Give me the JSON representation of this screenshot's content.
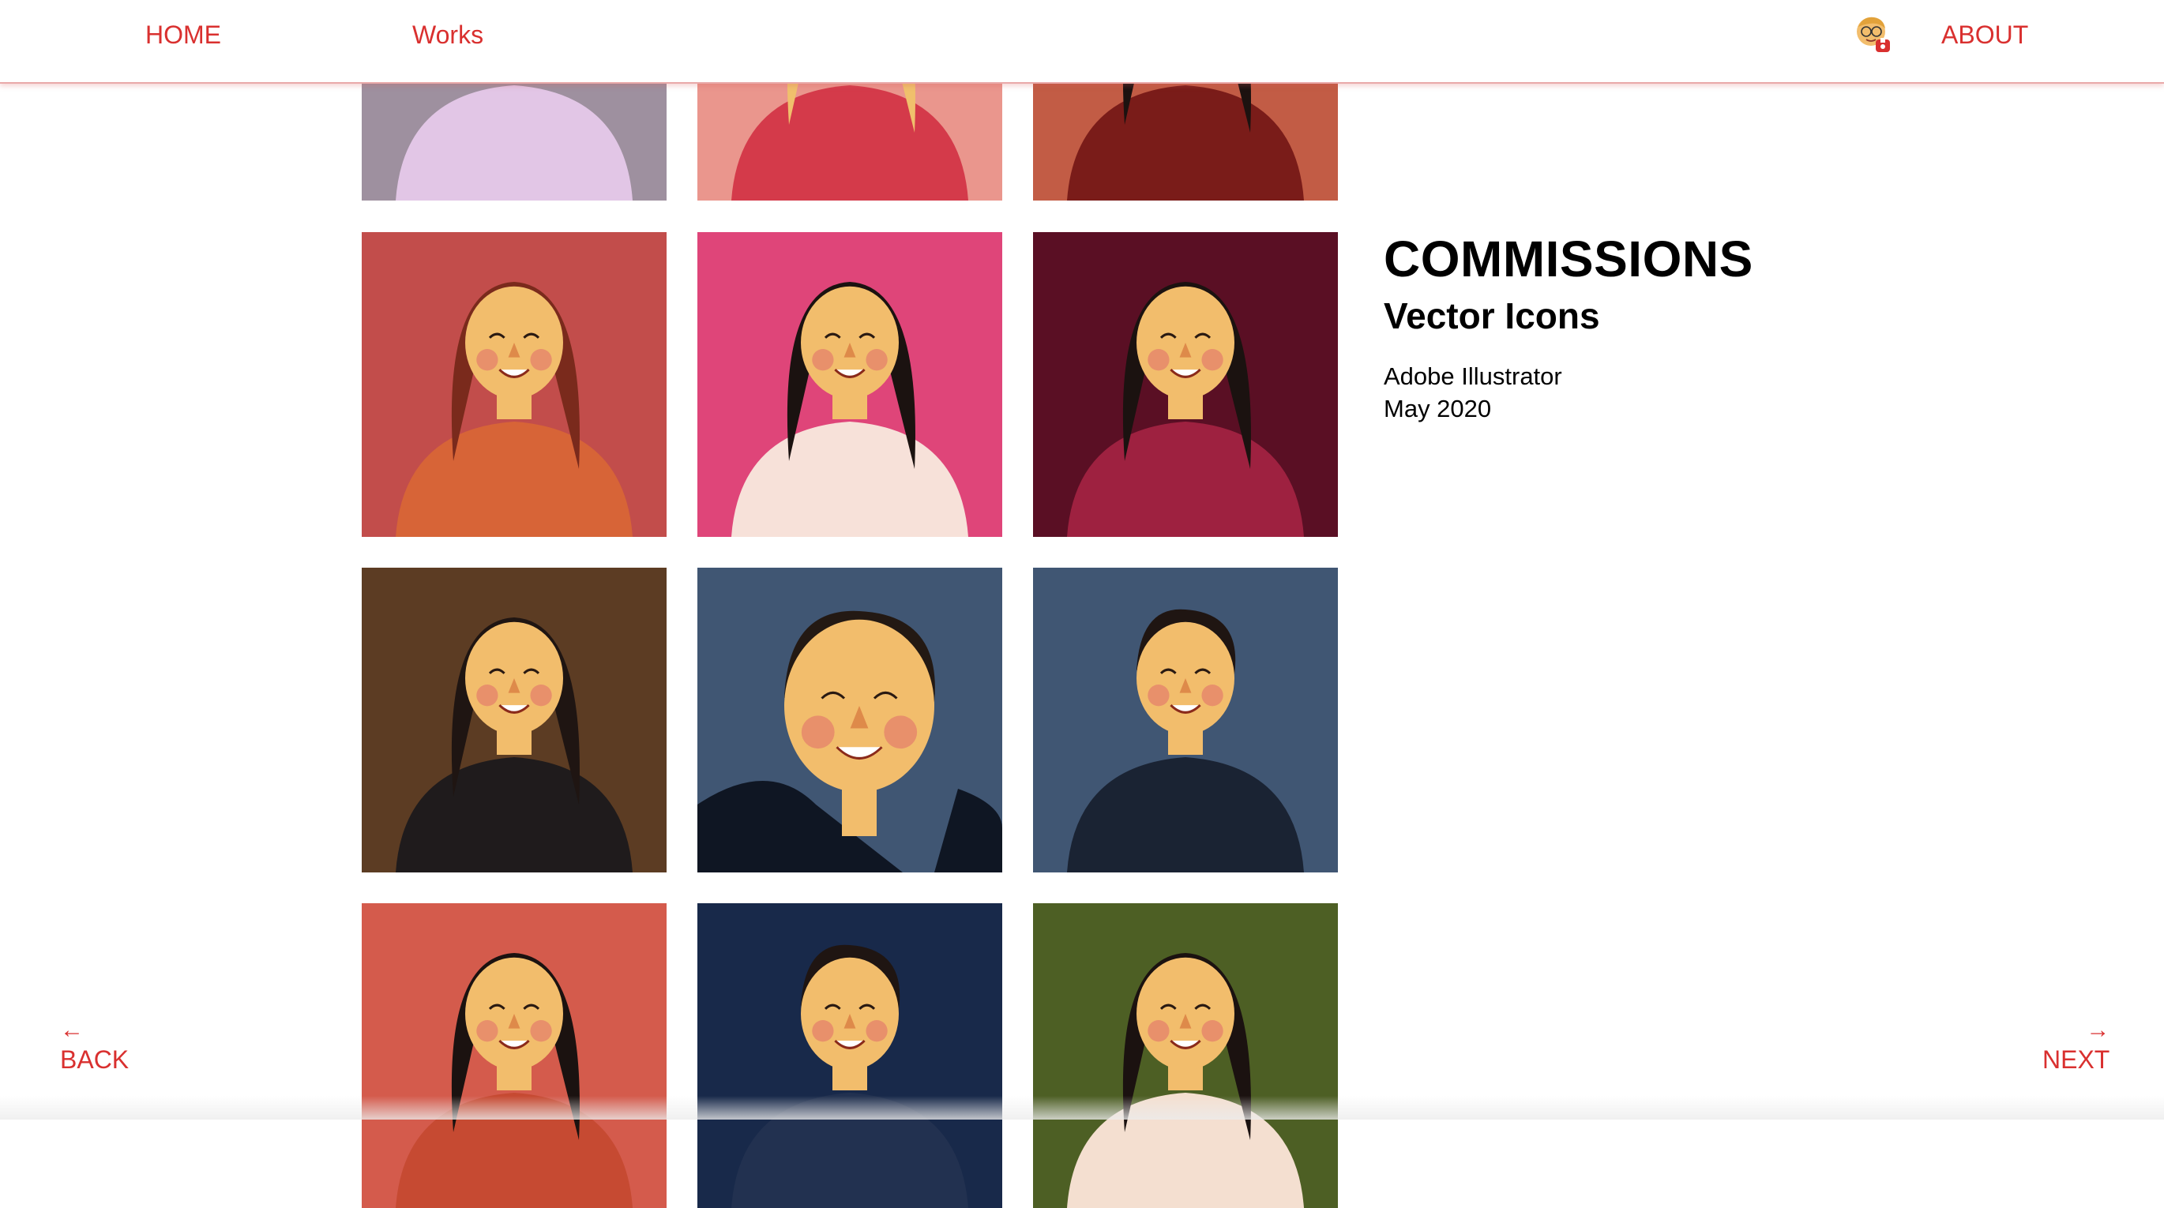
{
  "nav": {
    "home_label": "HOME",
    "works_label": "Works",
    "about_label": "ABOUT",
    "avatar_icon": "cartoon-avatar-icon"
  },
  "project": {
    "title": "COMMISSIONS",
    "subtitle": "Vector Icons",
    "tool": "Adobe Illustrator",
    "date": "May 2020"
  },
  "pager": {
    "back_label": "BACK",
    "back_icon": "arrow-left-icon",
    "next_label": "NEXT",
    "next_icon": "arrow-right-icon"
  },
  "portraits": [
    {
      "bg": "#9e909f",
      "hair": "#d9b08a",
      "shirt": "#e2c6e6",
      "type": "man-collar"
    },
    {
      "bg": "#ea968d",
      "hair": "#f0c06c",
      "shirt": "#d43a4a",
      "type": "woman-dress"
    },
    {
      "bg": "#c25c45",
      "hair": "#1c1210",
      "shirt": "#7a1c19",
      "type": "woman-hand"
    },
    {
      "bg": "#c24d4b",
      "hair": "#7a2a1c",
      "shirt": "#d76437",
      "type": "woman-glasses"
    },
    {
      "bg": "#df4579",
      "hair": "#1b1210",
      "shirt": "#f7e1d9",
      "type": "woman-sparkle"
    },
    {
      "bg": "#5a0f24",
      "hair": "#1b1210",
      "shirt": "#9e2140",
      "type": "woman-longhair"
    },
    {
      "bg": "#5c3c23",
      "hair": "#1f1512",
      "shirt": "#1f1b1c",
      "type": "woman-pearls"
    },
    {
      "bg": "#405673",
      "hair": "#231913",
      "shirt": "#0f1623",
      "type": "man-closeup"
    },
    {
      "bg": "#405673",
      "hair": "#1f1512",
      "shirt": "#1a2333",
      "type": "man-glasses"
    },
    {
      "bg": "#d45b4c",
      "hair": "#1b1210",
      "shirt": "#c64a32",
      "type": "woman-smile"
    },
    {
      "bg": "#18294a",
      "hair": "#1f1512",
      "shirt": "#223150",
      "type": "man-smile"
    },
    {
      "bg": "#4d5f24",
      "hair": "#1b1210",
      "shirt": "#f4dfd0",
      "type": "woman-laugh"
    }
  ],
  "colors": {
    "accent": "#d9302f",
    "skin": "#f2bd6c",
    "blush": "#e8906b"
  }
}
